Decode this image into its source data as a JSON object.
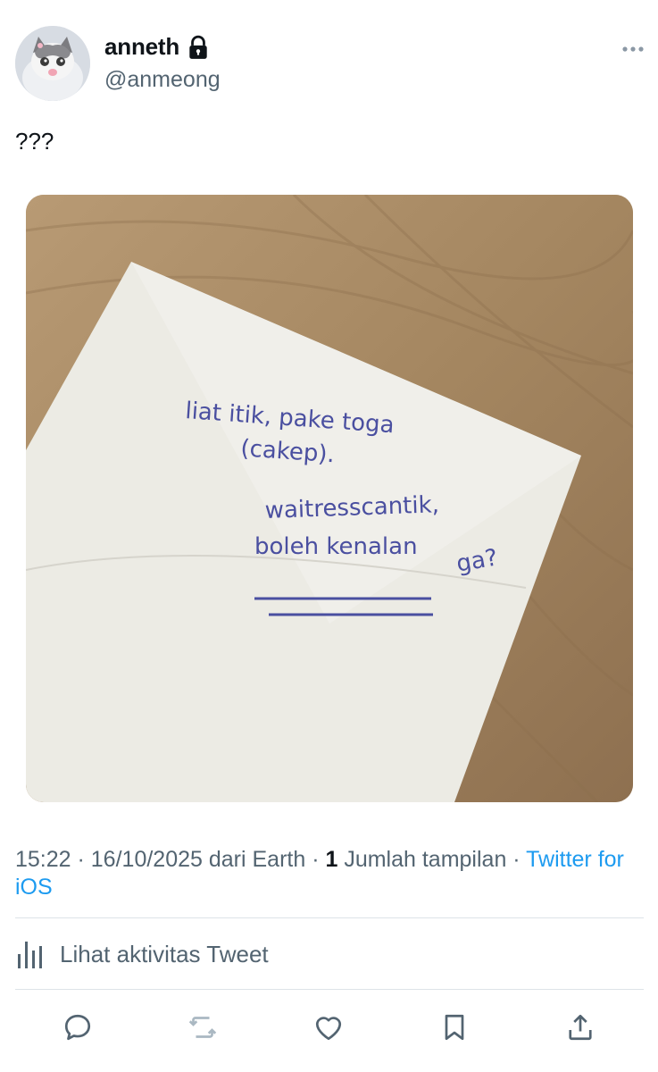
{
  "tweet": {
    "display_name": "anneth",
    "handle": "@anmeong",
    "text": "???",
    "media": {
      "note_lines": [
        "liat itik, pake toga",
        "(cakep).",
        "waitresscantik,",
        "boleh kenalan",
        "ga?"
      ]
    },
    "meta": {
      "time": "15:22",
      "sep1": " · ",
      "date": "16/10/2025",
      "source_prefix": " dari Earth",
      "sep2": " · ",
      "views_count": "1",
      "views_label": " Jumlah tampilan",
      "sep3": " · ",
      "client": "Twitter for iOS"
    },
    "activity_label": "Lihat aktivitas Tweet"
  },
  "icons": {
    "lock": "lock-icon",
    "more": "more-icon",
    "analytics": "bar-chart-icon",
    "reply": "reply-icon",
    "retweet": "retweet-icon",
    "like": "heart-icon",
    "bookmark": "bookmark-icon",
    "share": "share-icon"
  },
  "colors": {
    "link": "#1d9bf0",
    "secondary_text": "#536471",
    "primary_text": "#0f1419",
    "ink": "#4a4fa0"
  }
}
